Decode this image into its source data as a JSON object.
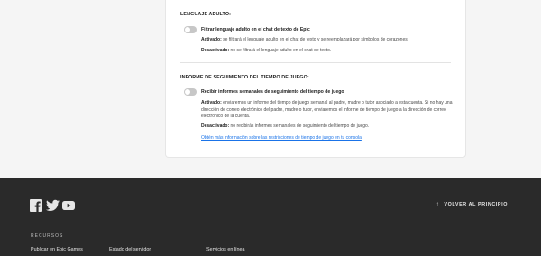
{
  "adult": {
    "title": "LENGUAJE ADULTO:",
    "toggle_label": "Filtrar lenguaje adulto en el chat de texto de Epic",
    "on_label": "Activado:",
    "on_text": " se filtrará el lenguaje adulto en el chat de texto y se reemplazará por símbolos de corazones.",
    "off_label": "Desactivado:",
    "off_text": " no se filtrará el lenguaje adulto en el chat de texto."
  },
  "playtime": {
    "title": "INFORME DE SEGUIMIENTO DEL TIEMPO DE JUEGO:",
    "toggle_label": "Recibir informes semanales de seguimiento del tiempo de juego",
    "on_label": "Activado:",
    "on_text": " enviaremos un informe del tiempo de juego semanal al padre, madre o tutor asociado a esta cuenta. Si no hay una dirección de correo electrónico del padre, madre o tutor, enviaremos el informe de tiempo de juego a la dirección de correo electrónico de la cuenta.",
    "off_label": "Desactivado:",
    "off_text": " no recibirás informes semanales de seguimiento del tiempo de juego.",
    "link": "Obtén más información sobre las restricciones de tiempo de juego en tu consola"
  },
  "footer": {
    "back_to_top": "VOLVER AL PRINCIPIO",
    "back_arrow": "↑",
    "resources_title": "RECURSOS",
    "links": [
      "Publicar en Epic Games",
      "Estado del servidor",
      "Servicios en línea"
    ],
    "social_icons": [
      "facebook-icon",
      "twitter-icon",
      "youtube-icon"
    ]
  },
  "colors": {
    "toggle_off": "#c7c7c7",
    "link": "#1a73e8",
    "footer_bg": "#2a2a2a"
  }
}
